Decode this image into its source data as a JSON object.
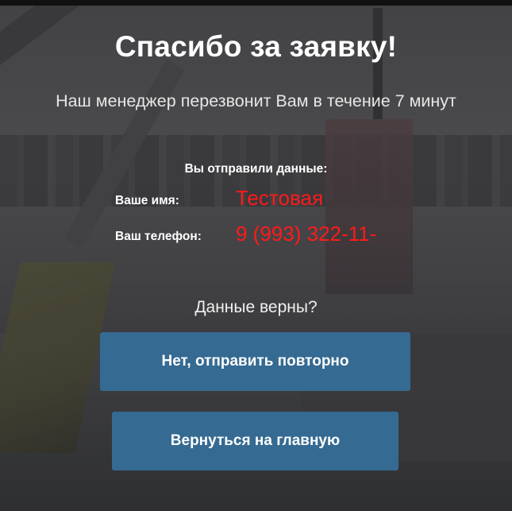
{
  "confirmation": {
    "title": "Спасибо за заявку!",
    "subtitle": "Наш менеджер перезвонит Вам в течение 7 минут",
    "sent_header": "Вы отправили данные:",
    "fields": [
      {
        "label": "Ваше имя:",
        "value": "Тестовая"
      },
      {
        "label": "Ваш телефон:",
        "value": "9 (993) 322-11-"
      }
    ],
    "question": "Данные верны?",
    "resend_button": "Нет, отправить повторно",
    "home_button": "Вернуться на главную"
  },
  "colors": {
    "value_text": "#ff1a1a",
    "button_bg": "#356a92",
    "title_text": "#ffffff"
  }
}
